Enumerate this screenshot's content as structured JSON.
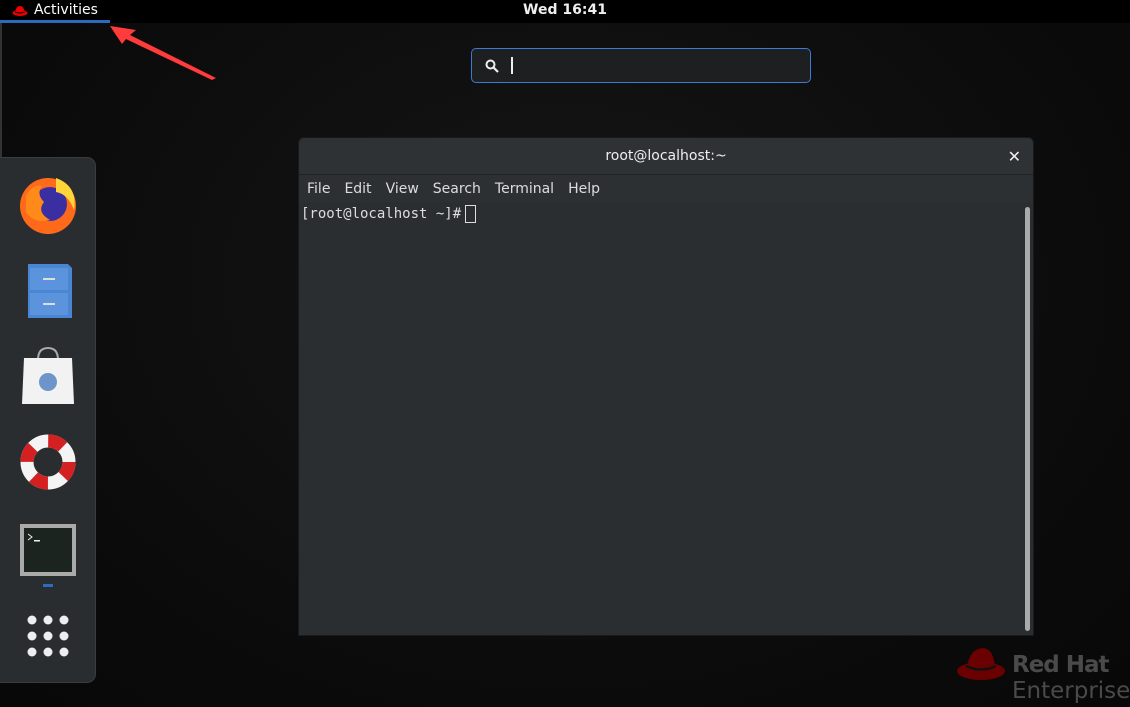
{
  "topbar": {
    "activities_label": "Activities",
    "clock": "Wed 16:41"
  },
  "search": {
    "placeholder": "",
    "value": ""
  },
  "dash": {
    "items": [
      {
        "name": "Firefox",
        "icon": "firefox-icon"
      },
      {
        "name": "Files",
        "icon": "file-cabinet-icon"
      },
      {
        "name": "Software",
        "icon": "shopping-bag-icon"
      },
      {
        "name": "Help",
        "icon": "lifebuoy-icon"
      },
      {
        "name": "Terminal",
        "icon": "terminal-icon",
        "running": true
      },
      {
        "name": "Show Applications",
        "icon": "app-grid-icon"
      }
    ]
  },
  "window": {
    "title": "root@localhost:~",
    "menu": [
      "File",
      "Edit",
      "View",
      "Search",
      "Terminal",
      "Help"
    ],
    "prompt": "[root@localhost ~]#"
  },
  "brand": {
    "line1": "Red Hat",
    "line2": "Enterprise"
  },
  "colors": {
    "accent": "#2a6bbf",
    "annotation_arrow": "#ff3b3b",
    "redhat": "#e00000"
  }
}
